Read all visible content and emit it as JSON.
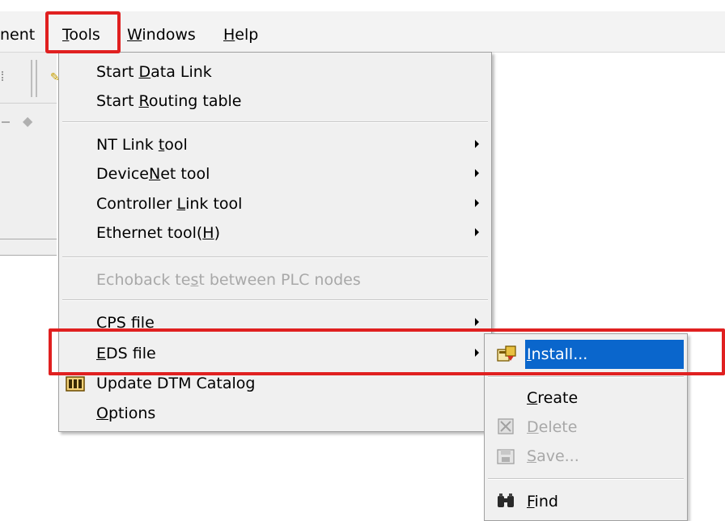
{
  "menubar": {
    "component_label": "nent",
    "tools": {
      "prefix": "",
      "u": "T",
      "rest": "ools"
    },
    "windows": {
      "u": "W",
      "rest": "indows"
    },
    "help": {
      "u": "H",
      "rest": "elp"
    }
  },
  "tools_menu": {
    "items": [
      {
        "pre": "Start ",
        "u": "D",
        "post": "ata Link"
      },
      {
        "pre": "Start ",
        "u": "R",
        "post": "outing table"
      },
      {
        "pre": "NT Link ",
        "u": "t",
        "post": "ool"
      },
      {
        "pre": "Device",
        "u": "N",
        "post": "et tool"
      },
      {
        "pre": "Controller ",
        "u": "L",
        "post": "ink tool"
      },
      {
        "pre": "Ethernet tool(",
        "u": "H",
        "post": ")"
      },
      {
        "pre": "Echoback te",
        "u": "s",
        "post": "t between PLC nodes"
      },
      {
        "pre": "CPS file",
        "u": "",
        "post": ""
      },
      {
        "pre": "",
        "u": "E",
        "post": "DS file"
      },
      {
        "pre": "Update DTM Catalog",
        "u": "",
        "post": ""
      },
      {
        "pre": "",
        "u": "O",
        "post": "ptions"
      }
    ]
  },
  "eds_submenu": {
    "items": [
      {
        "pre": "",
        "u": "I",
        "post": "nstall..."
      },
      {
        "pre": "",
        "u": "C",
        "post": "reate"
      },
      {
        "pre": "",
        "u": "D",
        "post": "elete"
      },
      {
        "pre": "",
        "u": "S",
        "post": "ave..."
      },
      {
        "pre": "",
        "u": "F",
        "post": "ind"
      }
    ]
  },
  "colors": {
    "highlight": "#0a66cc",
    "annotation": "#e02020",
    "disabled_text": "#a8a8a8"
  },
  "icons": {
    "install": "install-icon",
    "delete": "delete-icon",
    "save": "save-icon",
    "find": "binoculars-icon",
    "update_dtm": "catalog-icon"
  }
}
